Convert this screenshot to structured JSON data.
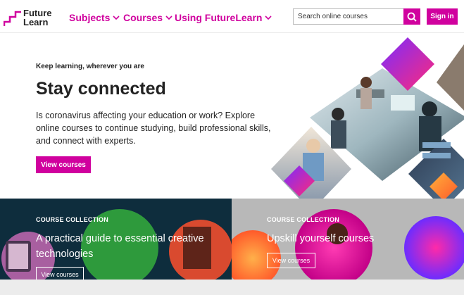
{
  "header": {
    "logo_line1": "Future",
    "logo_line2": "Learn",
    "nav": [
      {
        "label": "Subjects"
      },
      {
        "label": "Courses"
      },
      {
        "label": "Using FutureLearn"
      }
    ],
    "search_placeholder": "Search online courses",
    "signin_label": "Sign in"
  },
  "hero": {
    "kicker": "Keep learning, wherever you are",
    "title": "Stay connected",
    "description": "Is coronavirus affecting your education or work? Explore online courses to continue studying, build professional skills, and connect with experts.",
    "button_label": "View courses"
  },
  "collections": [
    {
      "label": "COURSE COLLECTION",
      "title": "A practical guide to essential creative technologies",
      "button_label": "View courses"
    },
    {
      "label": "COURSE COLLECTION",
      "title": "Upskill yourself courses",
      "button_label": "View courses"
    }
  ],
  "colors": {
    "brand": "#d0019e",
    "banner_left": "#0e2d3d",
    "banner_right": "#b8b8b8"
  },
  "icons": [
    "futurelearn-logo-icon",
    "chevron-down-icon",
    "search-icon"
  ]
}
